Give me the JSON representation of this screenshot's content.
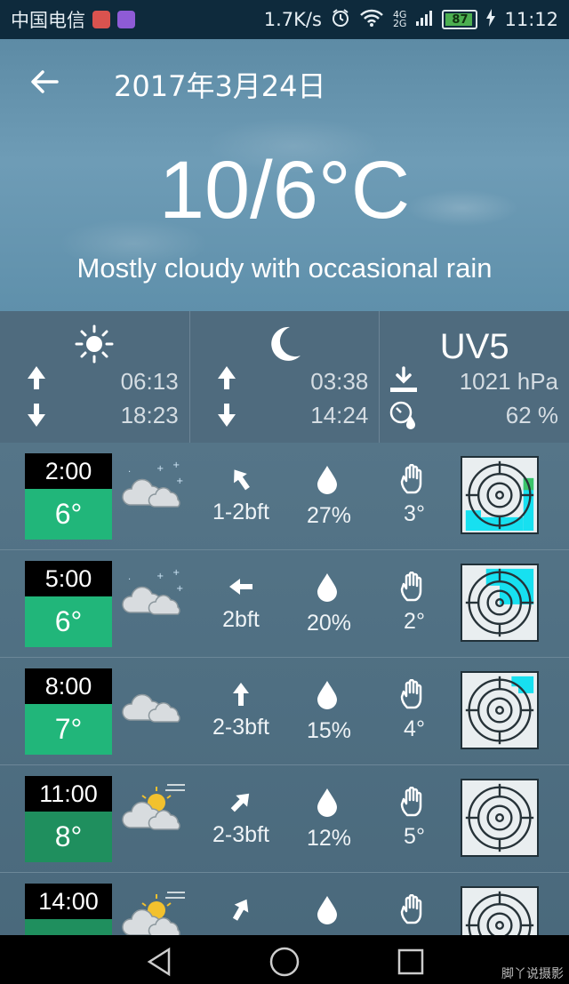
{
  "status_bar": {
    "carrier": "中国电信",
    "speed": "1.7K/s",
    "network": [
      "4G",
      "2G"
    ],
    "battery": "87",
    "time": "11:12"
  },
  "header": {
    "date": "2017年3月24日",
    "temperature": "10/6°C",
    "condition": "Mostly cloudy with occasional rain"
  },
  "info": {
    "sun": {
      "icon": "sun-icon",
      "rise": "06:13",
      "set": "18:23"
    },
    "moon": {
      "icon": "moon-icon",
      "rise": "03:38",
      "set": "14:24"
    },
    "uv": {
      "label": "UV5",
      "pressure": "1021 hPa",
      "humidity": "62 %"
    }
  },
  "hourly": [
    {
      "time": "2:00",
      "temp": "6°",
      "temp_color": "#21b67a",
      "weather_icon": "cloudy-night-icon",
      "wind": "1-2bft",
      "wind_dir_deg": -35,
      "precip": "27%",
      "uv_temp": "3°"
    },
    {
      "time": "5:00",
      "temp": "6°",
      "temp_color": "#21b67a",
      "weather_icon": "cloudy-night-icon",
      "wind": "2bft",
      "wind_dir_deg": -90,
      "precip": "20%",
      "uv_temp": "2°"
    },
    {
      "time": "8:00",
      "temp": "7°",
      "temp_color": "#21b67a",
      "weather_icon": "cloudy-icon",
      "wind": "2-3bft",
      "wind_dir_deg": 0,
      "precip": "15%",
      "uv_temp": "4°"
    },
    {
      "time": "11:00",
      "temp": "8°",
      "temp_color": "#1f8f5e",
      "weather_icon": "sun-cloud-rain-icon",
      "wind": "2-3bft",
      "wind_dir_deg": 45,
      "precip": "12%",
      "uv_temp": "5°"
    },
    {
      "time": "14:00",
      "temp": "",
      "temp_color": "#1f8f5e",
      "weather_icon": "sun-cloud-rain-icon",
      "wind": "",
      "wind_dir_deg": 30,
      "precip": "",
      "uv_temp": ""
    }
  ],
  "colors": {
    "accent_green": "#21b67a",
    "radar_cyan": "#17e0f0"
  },
  "watermark": "脚丫说摄影"
}
